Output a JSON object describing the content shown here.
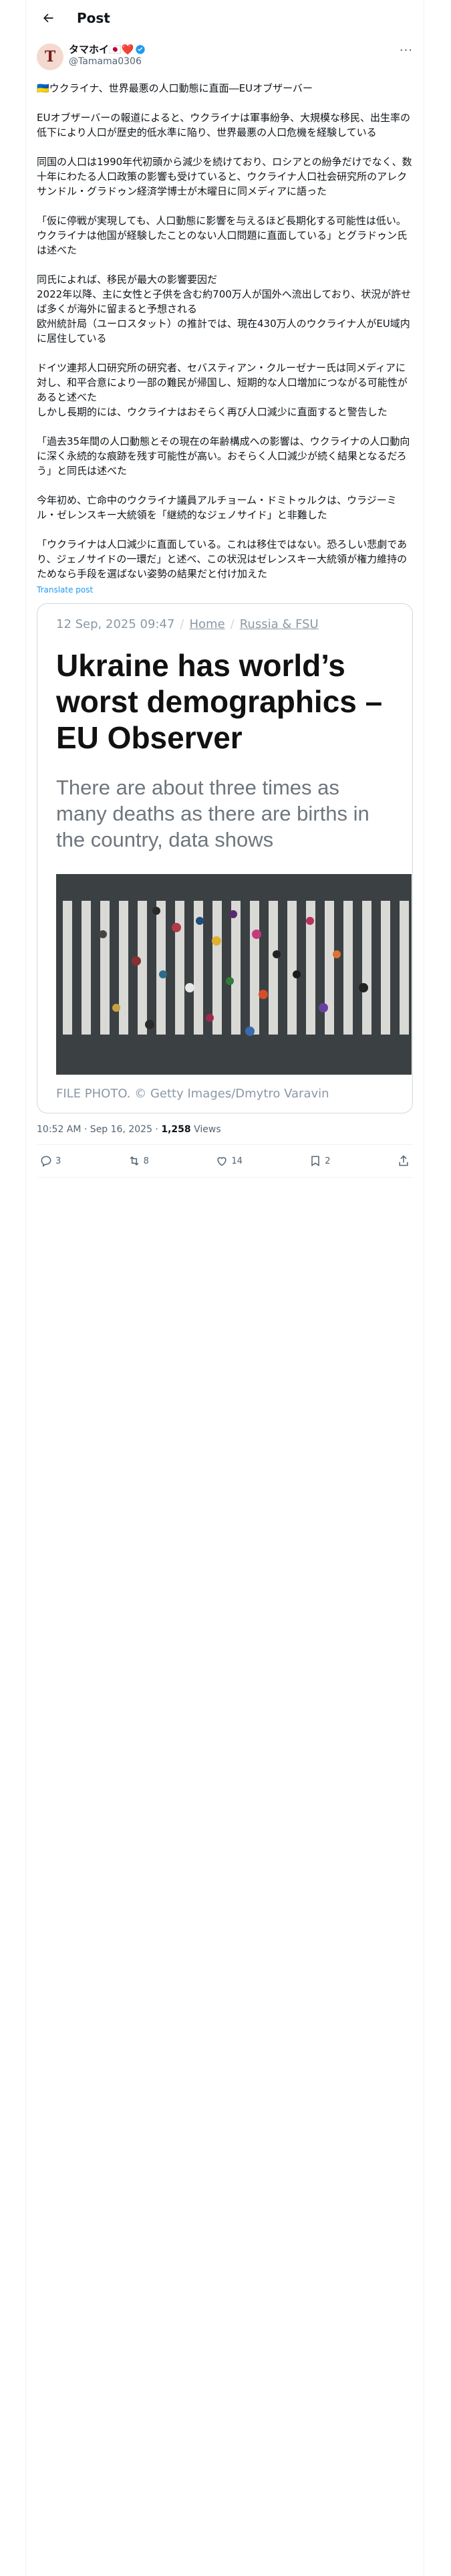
{
  "header": {
    "title": "Post"
  },
  "author": {
    "avatar_letter": "T",
    "name": "タマホイ🇯🇵❤️",
    "handle": "@Tamama0306"
  },
  "post": {
    "paragraphs": [
      "🇺🇦ウクライナ、世界最悪の人口動態に直面―EUオブザーバー",
      "EUオブザーバーの報道によると、ウクライナは軍事紛争、大規模な移民、出生率の低下により人口が歴史的低水準に陥り、世界最悪の人口危機を経験している",
      "同国の人口は1990年代初頭から減少を続けており、ロシアとの紛争だけでなく、数十年にわたる人口政策の影響も受けていると、ウクライナ人口社会研究所のアレクサンドル・グラドゥン経済学博士が木曜日に同メディアに語った",
      "「仮に停戦が実現しても、人口動態に影響を与えるほど長期化する可能性は低い。ウクライナは他国が経験したことのない人口問題に直面している」とグラドゥン氏は述べた",
      "同氏によれば、移民が最大の影響要因だ\n2022年以降、主に女性と子供を含む約700万人が国外へ流出しており、状況が許せば多くが海外に留まると予想される\n欧州統計局（ユーロスタット）の推計では、現在430万人のウクライナ人がEU域内に居住している",
      "ドイツ連邦人口研究所の研究者、セバスティアン・クルーゼナー氏は同メディアに対し、和平合意により一部の難民が帰国し、短期的な人口増加につながる可能性があると述べた\nしかし長期的には、ウクライナはおそらく再び人口減少に直面すると警告した",
      "「過去35年間の人口動態とその現在の年齢構成への影響は、ウクライナの人口動向に深く永続的な痕跡を残す可能性が高い。おそらく人口減少が続く結果となるだろう」と同氏は述べた",
      "今年初め、亡命中のウクライナ議員アルチョーム・ドミトゥルクは、ウラジーミル・ゼレンスキー大統領を「継続的なジェノサイド」と非難した",
      "「ウクライナは人口減少に直面している。これは移住ではない。恐ろしい悲劇であり、ジェノサイドの一環だ」と述べ、この状況はゼレンスキー大統領が権力維持のためなら手段を選ばない姿勢の結果だと付け加えた"
    ],
    "translate_label": "Translate post"
  },
  "card": {
    "date": "12 Sep, 2025 09:47",
    "crumb1": "Home",
    "crumb2": "Russia & FSU",
    "headline": "Ukraine has world’s worst demographics – EU Observer",
    "subtitle": "There are about three times as many deaths as there are births in the country, data shows",
    "caption": "FILE PHOTO. ©  Getty Images/Dmytro Varavin"
  },
  "meta": {
    "time": "10:52 AM · Sep 16, 2025 · ",
    "views_count": "1,258",
    "views_label": " Views"
  },
  "actions": {
    "replies": "3",
    "reposts": "8",
    "likes": "14",
    "bookmarks": "2"
  },
  "colors": {
    "accent": "#1d9bf0",
    "text": "#0f1419",
    "muted": "#536471"
  }
}
